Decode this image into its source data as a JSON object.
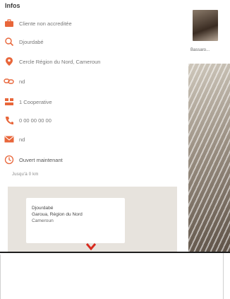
{
  "info": {
    "title": "Infos",
    "rows": [
      {
        "icon": "briefcase-icon",
        "text": "Cliente non accreditée"
      },
      {
        "icon": "search-icon",
        "text": "Djourdabé"
      },
      {
        "icon": "location-pin-icon",
        "text": "Cercle Région du Nord, Cameroun"
      },
      {
        "icon": "link-icon",
        "text": "nd"
      },
      {
        "icon": "group-icon",
        "text": "1 Cooperative"
      },
      {
        "icon": "phone-icon",
        "text": "0 00 00 00 00"
      },
      {
        "icon": "mail-icon",
        "text": "nd"
      },
      {
        "icon": "clock-icon",
        "text": "Ouvert maintenant"
      }
    ],
    "sub_note": "Jusqu'à 0 km"
  },
  "map": {
    "line1": "Djourdabé",
    "line2": "Garoua, Région du Nord",
    "line3": "Cameroun"
  },
  "gallery": {
    "caption": "Bassaro..."
  },
  "colors": {
    "accent": "#e8663a",
    "divider": "#1e1e1e"
  }
}
